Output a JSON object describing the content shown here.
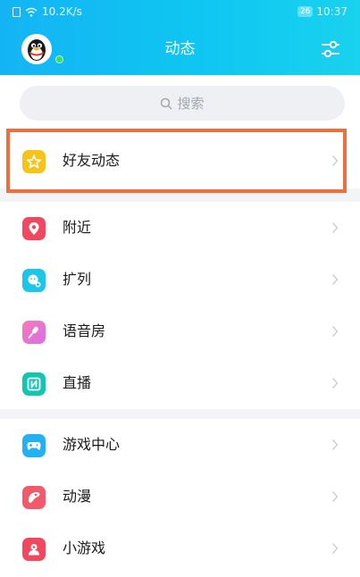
{
  "statusbar": {
    "speed": "10.2K/s",
    "battery": "26",
    "time": "10:37"
  },
  "header": {
    "title": "动态"
  },
  "search": {
    "placeholder": "搜索"
  },
  "section1": {
    "items": [
      {
        "label": "好友动态",
        "icon": "star-icon",
        "color": "#f7c21a"
      }
    ]
  },
  "section2": {
    "items": [
      {
        "label": "附近",
        "icon": "location-pin-icon",
        "color": "#f2485f"
      },
      {
        "label": "扩列",
        "icon": "add-friend-icon",
        "color": "#1cc6e8"
      },
      {
        "label": "语音房",
        "icon": "microphone-icon",
        "color": "#f26ab8"
      },
      {
        "label": "直播",
        "icon": "live-icon",
        "color": "#12c7b2"
      }
    ]
  },
  "section3": {
    "items": [
      {
        "label": "游戏中心",
        "icon": "gamepad-icon",
        "color": "#22b2f4"
      },
      {
        "label": "动漫",
        "icon": "comic-icon",
        "color": "#f2596a"
      },
      {
        "label": "小游戏",
        "icon": "mini-game-icon",
        "color": "#f2485f"
      }
    ]
  },
  "colors": {
    "header_start": "#14b4f4",
    "header_end": "#19d2ee",
    "highlight_border": "#ee6f3d",
    "section_gap": "#f3f4f7"
  }
}
